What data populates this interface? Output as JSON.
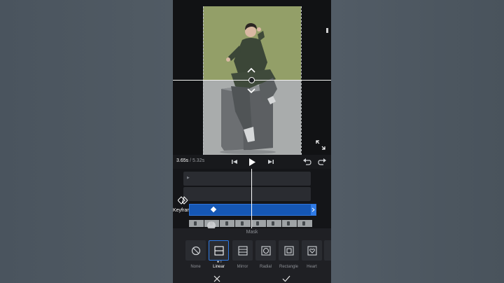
{
  "player": {
    "current_time": "3.65s",
    "total_time": "/ 5.32s",
    "playhead_fraction": 0.686
  },
  "timeline": {
    "keyframe_label": "Keyframe",
    "track_tag": "▶"
  },
  "mask_panel": {
    "title": "Mask",
    "selected": "Linear",
    "options": [
      {
        "label": "None",
        "icon": "none-icon"
      },
      {
        "label": "Linear",
        "icon": "linear-mask-icon"
      },
      {
        "label": "Mirror",
        "icon": "mirror-mask-icon"
      },
      {
        "label": "Radial",
        "icon": "radial-mask-icon"
      },
      {
        "label": "Rectangle",
        "icon": "rectangle-mask-icon"
      },
      {
        "label": "Heart",
        "icon": "heart-mask-icon"
      }
    ]
  },
  "colors": {
    "accent": "#2f7be6",
    "clip": "#1557b4",
    "photo_top": "#939f68",
    "photo_bottom": "#a9acac"
  }
}
